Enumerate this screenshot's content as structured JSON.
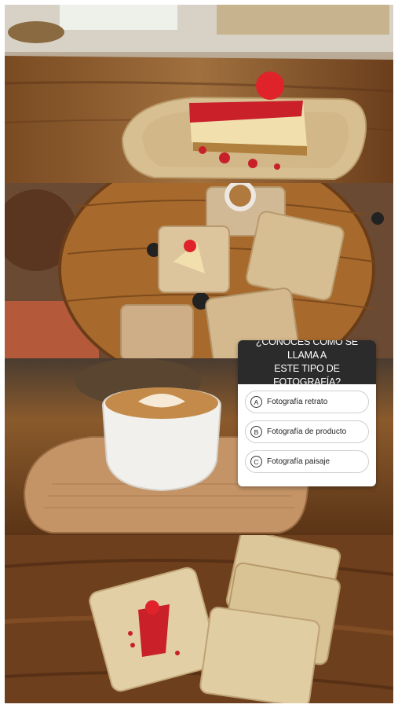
{
  "story": {
    "panels": [
      {
        "scene": "Cheesecake with strawberry sauce on square palm-leaf plate by a window"
      },
      {
        "scene": "Top view of a wooden cable-spool table with palm-leaf plates, cheesecake and latte"
      },
      {
        "scene": "Latte art cup on rectangular palm-leaf tray"
      },
      {
        "scene": "Cheesecake slice on square palm-leaf plate beside a stack of plates"
      }
    ]
  },
  "quiz": {
    "question": "¿CONOCES CÓMO SE LLAMA A\nESTE TIPO DE FOTOGRAFÍA?",
    "options": [
      {
        "letter": "A",
        "label": "Fotografía retrato"
      },
      {
        "letter": "B",
        "label": "Fotografía de producto"
      },
      {
        "letter": "C",
        "label": "Fotografía paisaje"
      }
    ]
  },
  "colors": {
    "quiz_header_bg": "#2b2b2b",
    "quiz_bg": "#ffffff",
    "wood": "#8a5a2e",
    "sauce": "#c8202a"
  }
}
